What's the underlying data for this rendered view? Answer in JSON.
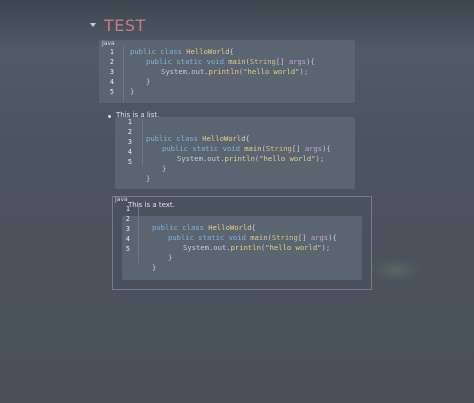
{
  "heading": {
    "title": "TEST"
  },
  "block1": {
    "lang": "Java",
    "line_numbers": [
      "1",
      "2",
      "3",
      "4",
      "5"
    ]
  },
  "list": {
    "item_text": "This is a list."
  },
  "block2": {
    "line_numbers": [
      "1",
      "2",
      "3",
      "4",
      "5"
    ]
  },
  "block3": {
    "lang": "Java",
    "text": "This is a text.",
    "line_numbers": [
      "1",
      "2",
      "3",
      "4",
      "5"
    ]
  },
  "code": {
    "l1_kw": "public class ",
    "l1_fn": "HelloWorld",
    "l1_pl": "{",
    "l2_kw": "public static void ",
    "l2_fn": "main",
    "l2_pl1": "(",
    "l2_tp": "String",
    "l2_pl2": "[] ",
    "l2_ar": "args",
    "l2_pl3": "){",
    "l3_pl1": "System.out.",
    "l3_fn": "println",
    "l3_pl2": "(",
    "l3_st": "\"hello world\"",
    "l3_pl3": ");",
    "l4": "}",
    "l5": "}"
  },
  "colors": {
    "heading": "#c97b84",
    "code_bg": "#5b6471",
    "keyword": "#7db4df"
  }
}
